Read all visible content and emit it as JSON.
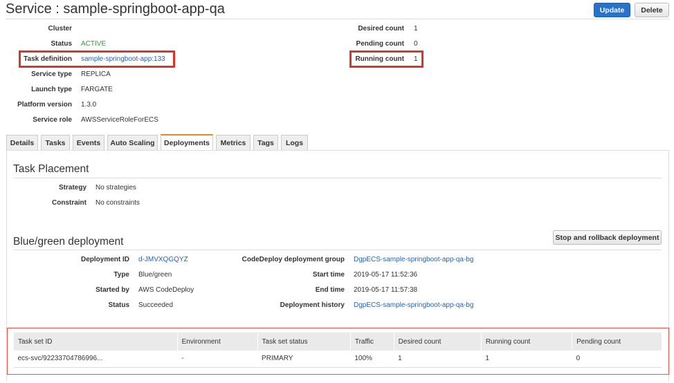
{
  "header": {
    "title": "Service : sample-springboot-app-qa",
    "update_label": "Update",
    "delete_label": "Delete"
  },
  "service_info": {
    "left": [
      {
        "label": "Cluster",
        "value": ""
      },
      {
        "label": "Status",
        "value": "ACTIVE"
      },
      {
        "label": "Task definition",
        "value": "sample-springboot-app:133"
      },
      {
        "label": "Service type",
        "value": "REPLICA"
      },
      {
        "label": "Launch type",
        "value": "FARGATE"
      },
      {
        "label": "Platform version",
        "value": "1.3.0"
      },
      {
        "label": "Service role",
        "value": "AWSServiceRoleForECS"
      }
    ],
    "right": [
      {
        "label": "Desired count",
        "value": "1"
      },
      {
        "label": "Pending count",
        "value": "0"
      },
      {
        "label": "Running count",
        "value": "1"
      }
    ]
  },
  "tabs": [
    "Details",
    "Tasks",
    "Events",
    "Auto Scaling",
    "Deployments",
    "Metrics",
    "Tags",
    "Logs"
  ],
  "task_placement": {
    "heading": "Task Placement",
    "rows": [
      {
        "label": "Strategy",
        "value": "No strategies"
      },
      {
        "label": "Constraint",
        "value": "No constraints"
      }
    ]
  },
  "bluegreen": {
    "heading": "Blue/green deployment",
    "rollback_label": "Stop and rollback deployment",
    "left": [
      {
        "label": "Deployment ID",
        "value": "d-JMVXQGQYZ"
      },
      {
        "label": "Type",
        "value": "Blue/green"
      },
      {
        "label": "Started by",
        "value": "AWS CodeDeploy"
      },
      {
        "label": "Status",
        "value": "Succeeded"
      }
    ],
    "right": [
      {
        "label": "CodeDeploy deployment group",
        "value": "DgpECS-sample-springboot-app-qa-bg"
      },
      {
        "label": "Start time",
        "value": "2019-05-17 11:52:36"
      },
      {
        "label": "End time",
        "value": "2019-05-17 11:57:38"
      },
      {
        "label": "Deployment history",
        "value": "DgpECS-sample-springboot-app-qa-bg"
      }
    ]
  },
  "task_sets": {
    "columns": [
      "Task set ID",
      "Environment",
      "Task set status",
      "Traffic",
      "Desired count",
      "Running count",
      "Pending count"
    ],
    "rows": [
      [
        "ecs-svc/92233704786996...",
        "-",
        "PRIMARY",
        "100%",
        "1",
        "1",
        "0"
      ]
    ]
  }
}
